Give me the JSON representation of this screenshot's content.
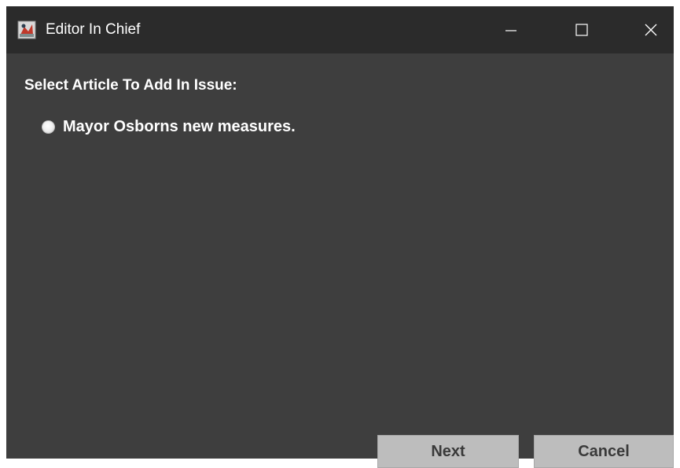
{
  "window": {
    "title": "Editor In Chief",
    "icon": "java-app-icon"
  },
  "controls": {
    "minimize_icon": "minimize-icon",
    "maximize_icon": "maximize-icon",
    "close_icon": "close-icon"
  },
  "main": {
    "prompt": "Select Article To Add In Issue:",
    "articles": [
      {
        "label": "Mayor Osborns new measures.",
        "selected": false
      }
    ]
  },
  "buttons": {
    "next_label": "Next",
    "cancel_label": "Cancel"
  },
  "colors": {
    "titlebar": "#2b2b2b",
    "background": "#3e3e3e",
    "button_bg": "#bdbdbd",
    "text": "#ffffff"
  }
}
